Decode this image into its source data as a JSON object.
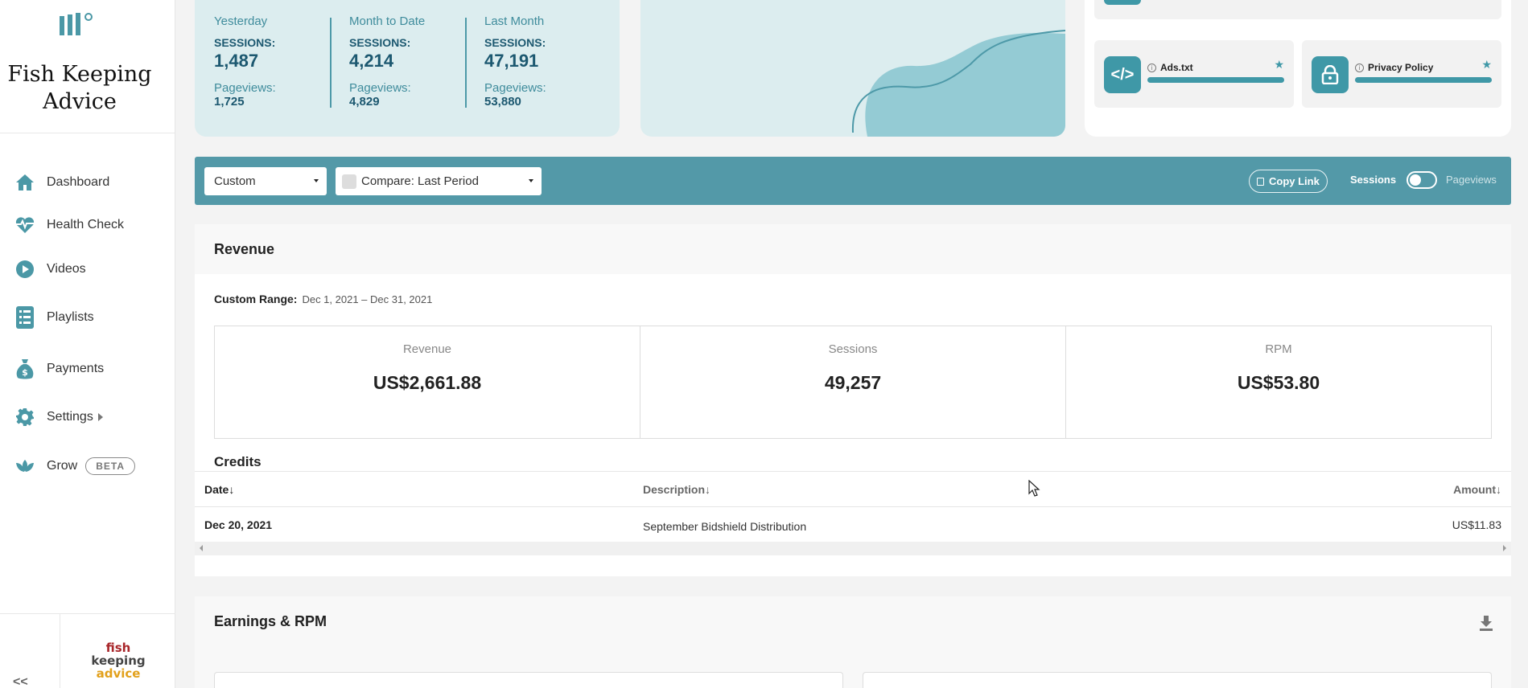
{
  "brand": {
    "name": "Fish Keeping Advice",
    "site_logo_lines": [
      "fish",
      "keeping",
      "advice"
    ]
  },
  "sidebar": {
    "items": [
      {
        "label": "Dashboard",
        "icon": "home-icon"
      },
      {
        "label": "Health Check",
        "icon": "heartbeat-icon"
      },
      {
        "label": "Videos",
        "icon": "play-icon"
      },
      {
        "label": "Playlists",
        "icon": "list-icon"
      },
      {
        "label": "Payments",
        "icon": "money-bag-icon"
      },
      {
        "label": "Settings",
        "icon": "gear-icon"
      },
      {
        "label": "Grow",
        "icon": "lotus-icon",
        "badge": "BETA"
      }
    ],
    "collapse_label": "<<"
  },
  "stats": {
    "columns": [
      {
        "label": "Yesterday",
        "sessions_label": "SESSIONS:",
        "sessions": "1,487",
        "pageviews_label": "Pageviews:",
        "pageviews": "1,725"
      },
      {
        "label": "Month to Date",
        "sessions_label": "SESSIONS:",
        "sessions": "4,214",
        "pageviews_label": "Pageviews:",
        "pageviews": "4,829"
      },
      {
        "label": "Last Month",
        "sessions_label": "SESSIONS:",
        "sessions": "47,191",
        "pageviews_label": "Pageviews:",
        "pageviews": "53,880"
      }
    ]
  },
  "tools": [
    {
      "label": "Ads.txt",
      "icon": "code-icon"
    },
    {
      "label": "Privacy Policy",
      "icon": "lock-icon"
    }
  ],
  "filter_bar": {
    "range_select": "Custom",
    "compare_select": "Compare: Last Period",
    "copy_link": "Copy Link",
    "toggle_left": "Sessions",
    "toggle_right": "Pageviews"
  },
  "revenue": {
    "title": "Revenue",
    "range_label": "Custom Range:",
    "range_value": "Dec 1, 2021 – Dec 31, 2021",
    "metrics": [
      {
        "label": "Revenue",
        "value": "US$2,661.88"
      },
      {
        "label": "Sessions",
        "value": "49,257"
      },
      {
        "label": "RPM",
        "value": "US$53.80"
      }
    ],
    "credits": {
      "title": "Credits",
      "headers": {
        "date": "Date↓",
        "description": "Description↓",
        "amount": "Amount↓"
      },
      "rows": [
        {
          "date": "Dec 20, 2021",
          "description": "September Bidshield Distribution",
          "amount": "US$11.83"
        }
      ]
    }
  },
  "earnings": {
    "title": "Earnings & RPM"
  },
  "colors": {
    "accent": "#5399a8",
    "accent_dark": "#1c5870",
    "card_bg": "#dcedef"
  }
}
